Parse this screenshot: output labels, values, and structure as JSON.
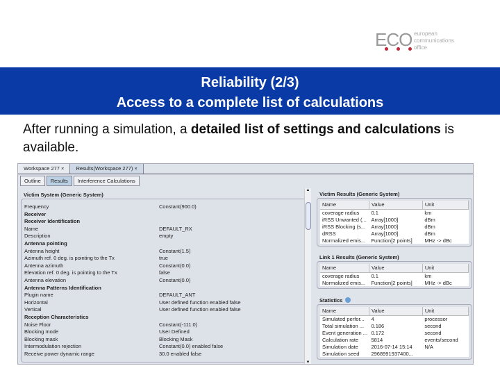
{
  "logo": {
    "mark": "ECO",
    "words": [
      "european",
      "communications",
      "office"
    ]
  },
  "banner": {
    "line1": "Reliability (2/3)",
    "line2": "Access to a complete list of calculations"
  },
  "intro": {
    "a": "After running a simulation, a ",
    "b": "detailed list of settings and calculations",
    "c": " is available."
  },
  "tabs": [
    "Workspace 277 ×",
    "Results(Workspace 277) ×"
  ],
  "subtabs": [
    "Outline",
    "Results",
    "Interference Calculations"
  ],
  "victim_system": {
    "title": "Victim System (Generic System)",
    "rows": [
      {
        "name": "Frequency",
        "value": "Constant(900.0)",
        "header": false
      },
      {
        "name": "Receiver",
        "value": "",
        "header": true
      },
      {
        "name": "Receiver Identification",
        "value": "",
        "header": true
      },
      {
        "name": "Name",
        "value": "DEFAULT_RX",
        "header": false
      },
      {
        "name": "Description",
        "value": "empty",
        "header": false
      },
      {
        "name": "Antenna pointing",
        "value": "",
        "header": true
      },
      {
        "name": "Antenna height",
        "value": "Constant(1.5)",
        "header": false
      },
      {
        "name": "Azimuth ref. 0 deg. is pointing to the Tx",
        "value": "true",
        "header": false
      },
      {
        "name": "Antenna azimuth",
        "value": "Constant(0.0)",
        "header": false
      },
      {
        "name": "Elevation ref. 0 deg. is pointing to the Tx",
        "value": "false",
        "header": false
      },
      {
        "name": "Antenna elevation",
        "value": "Constant(0.0)",
        "header": false
      },
      {
        "name": "Antenna Patterns Identification",
        "value": "",
        "header": true
      },
      {
        "name": "Plugin name",
        "value": "DEFAULT_ANT",
        "header": false
      },
      {
        "name": "Horizontal",
        "value": "User defined function enabled false",
        "header": false
      },
      {
        "name": "Vertical",
        "value": "User defined function enabled false",
        "header": false
      },
      {
        "name": "Reception Characteristics",
        "value": "",
        "header": true
      },
      {
        "name": "Noise Floor",
        "value": "Constant(-111.0)",
        "header": false
      },
      {
        "name": "Blocking mode",
        "value": "User Defined",
        "header": false
      },
      {
        "name": "Blocking mask",
        "value": "Blocking Mask",
        "header": false
      },
      {
        "name": "Intermodulation rejection",
        "value": "Constant(0.0) enabled false",
        "header": false
      },
      {
        "name": "Receive power dynamic range",
        "value": "30.0 enabled false",
        "header": false
      }
    ]
  },
  "columns": [
    "Name",
    "Value",
    "Unit"
  ],
  "victim_results": {
    "title": "Victim Results (Generic System)",
    "rows": [
      [
        "coverage radius",
        "0.1",
        "km"
      ],
      [
        "iRSS Unwanted (...",
        "Array[1000]",
        "dBm"
      ],
      [
        "iRSS Blocking (s...",
        "Array[1000]",
        "dBm"
      ],
      [
        "dRSS",
        "Array[1000]",
        "dBm"
      ],
      [
        "Normalized emis...",
        "Function[2 points]",
        "MHz -> dBc"
      ]
    ]
  },
  "link1_results": {
    "title": "Link 1 Results (Generic System)",
    "rows": [
      [
        "coverage radius",
        "0.1",
        "km"
      ],
      [
        "Normalized emis...",
        "Function[2 points]",
        "MHz -> dBc"
      ]
    ]
  },
  "statistics": {
    "title": "Statistics",
    "rows": [
      [
        "Simulated perfor...",
        "4",
        "processor"
      ],
      [
        "Total simulation ...",
        "0.186",
        "second"
      ],
      [
        "Event generation ...",
        "0.172",
        "second"
      ],
      [
        "Calculation rate",
        "5814",
        "events/second"
      ],
      [
        "Simulation date",
        "2016-07-14 15:14",
        "N/A"
      ],
      [
        "Simulation seed",
        "2968991937400...",
        ""
      ]
    ]
  }
}
